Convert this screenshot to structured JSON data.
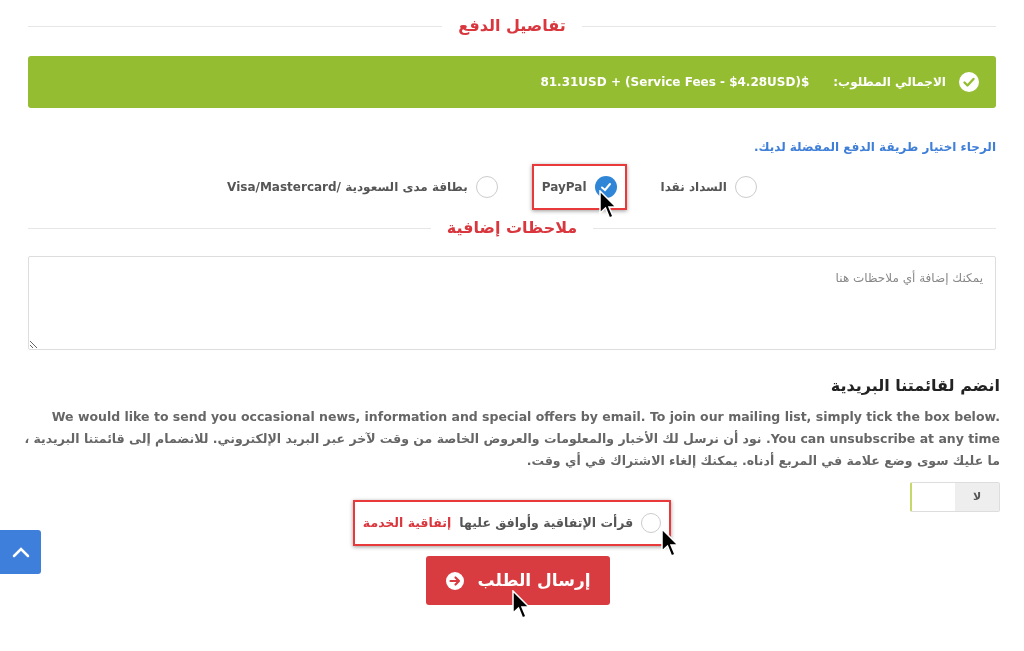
{
  "payment_title": "تفاصيل الدفع",
  "total": {
    "label": "الاجمالي المطلوب:",
    "amount": "81.31USD + (Service Fees - $4.28USD)$"
  },
  "payment_prompt": "الرجاء اختيار طريقة الدفع المفضلة لديك.",
  "payment_methods": [
    {
      "label": "السداد نقدا",
      "selected": false,
      "highlighted": false
    },
    {
      "label": "PayPal",
      "selected": true,
      "highlighted": true
    },
    {
      "label": "بطاقة مدى السعودية /Visa/Mastercard",
      "selected": false,
      "highlighted": false
    }
  ],
  "notes_title": "ملاحظات إضافية",
  "notes": {
    "placeholder": "يمكنك إضافة أي ملاحظات هنا"
  },
  "mailing": {
    "title": "انضم لقائمتنا البريدية",
    "text": "We would like to send you occasional news, information and special offers by email. To join our mailing list, simply tick the box below. You can unsubscribe at any time. نود أن نرسل لك الأخبار والمعلومات والعروض الخاصة من وقت لآخر عبر البريد الإلكتروني. للانضمام إلى قائمتنا البريدية ، ما عليك سوى وضع علامة في المربع أدناه. يمكنك إلغاء الاشتراك في أي وقت.",
    "toggle": {
      "label": "لا",
      "on": false
    }
  },
  "agreement": {
    "text": "قرأت الإتفاقية وأوافق عليها",
    "link": "إتفاقية الخدمة",
    "checked": false,
    "highlighted": true
  },
  "submit": "إرسال الطلب"
}
